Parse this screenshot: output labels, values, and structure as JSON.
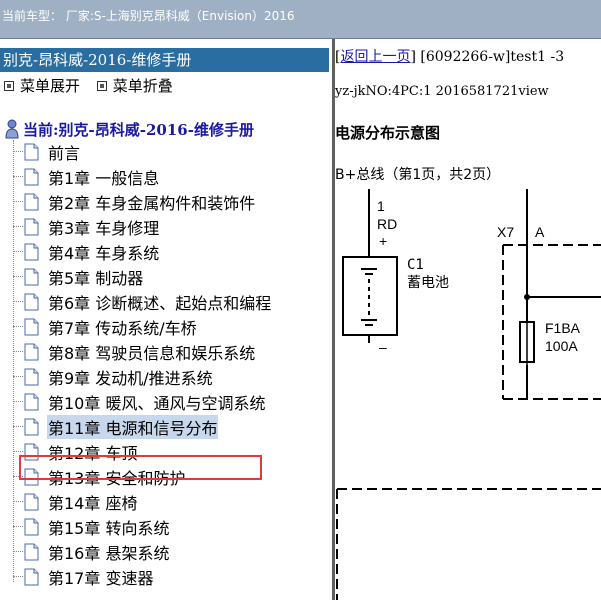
{
  "header": {
    "vehicle_text": "当前车型：  厂家:S-上海别克昂科威（Envision）2016"
  },
  "sidebar": {
    "manual_title": "别克-昂科威-2016-维修手册",
    "expand_label": "菜单展开",
    "collapse_label": "菜单折叠",
    "current_label": "当前:别克-昂科威-2016-维修手册",
    "items": [
      {
        "label": "前言"
      },
      {
        "label": "第1章 一般信息"
      },
      {
        "label": "第2章 车身金属构件和装饰件"
      },
      {
        "label": "第3章 车身修理"
      },
      {
        "label": "第4章 车身系统"
      },
      {
        "label": "第5章 制动器"
      },
      {
        "label": "第6章 诊断概述、起始点和编程"
      },
      {
        "label": "第7章 传动系统/车桥"
      },
      {
        "label": "第8章 驾驶员信息和娱乐系统"
      },
      {
        "label": "第9章 发动机/推进系统"
      },
      {
        "label": "第10章 暖风、通风与空调系统"
      },
      {
        "label": "第11章 电源和信号分布"
      },
      {
        "label": "第12章 车顶"
      },
      {
        "label": "第13章 安全和防护"
      },
      {
        "label": "第14章 座椅"
      },
      {
        "label": "第15章 转向系统"
      },
      {
        "label": "第16章 悬架系统"
      },
      {
        "label": "第17章 变速器"
      }
    ],
    "selected_index": 11
  },
  "content": {
    "back_link": "返回上一页",
    "doc_ref": "[6092266-w]test1 -3",
    "doc_id": "yz-jkNO:4PC:1 2016581721view",
    "diagram_title": "电源分布示意图",
    "bus_caption": "B+总线（第1页，共2页）",
    "schematic": {
      "wire_num": "1",
      "wire_color": "RD",
      "plus": "+",
      "minus": "–",
      "battery_ref": "C1",
      "battery_name": "蓄电池",
      "connector": "X7",
      "pin": "A",
      "fuse_name": "F1BA",
      "fuse_rating": "100A"
    }
  }
}
